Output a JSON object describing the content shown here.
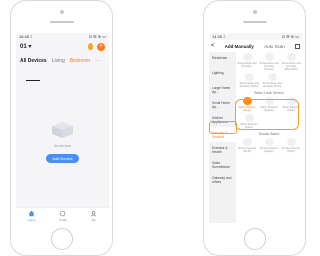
{
  "left_phone": {
    "status": {
      "time": "16:45 ☾",
      "icons": "⊡ ☰ ≋ ▭"
    },
    "home_name": "01 ▾",
    "tabs": [
      {
        "label": "All Devices",
        "state": "active"
      },
      {
        "label": "Living",
        "state": "inactive"
      },
      {
        "label": "Bedroom",
        "state": "orange"
      },
      {
        "label": "···",
        "state": "orange"
      }
    ],
    "empty_text": "No devices",
    "add_device_label": "Add Device",
    "nav": [
      {
        "label": "Home",
        "icon": "home-icon",
        "state": "active"
      },
      {
        "label": "Smart",
        "icon": "smart-icon",
        "state": "inactive"
      },
      {
        "label": "Me",
        "icon": "profile-icon",
        "state": "inactive"
      }
    ]
  },
  "right_phone": {
    "status": {
      "time": "14:35 ☾",
      "icons": "⊡ ☰ ≋ ▭"
    },
    "back": "<",
    "tab_manual": "Add Manually",
    "tab_auto": "Auto Scan",
    "categories": [
      {
        "label": "Electrician",
        "selected": false
      },
      {
        "label": "Lighting",
        "selected": false
      },
      {
        "label": "Large Home Ap...",
        "selected": false
      },
      {
        "label": "Small Home Ap...",
        "selected": false
      },
      {
        "label": "Kitchen Appliances",
        "selected": false
      },
      {
        "label": "Security & Sensors",
        "selected": true
      },
      {
        "label": "Exercise & Health",
        "selected": false
      },
      {
        "label": "Video Surveillance",
        "selected": false
      },
      {
        "label": "Gateway and others",
        "selected": false
      }
    ],
    "group_top": [
      {
        "label": "Temperature and Humidity...",
        "highlight": false
      },
      {
        "label": "Temperature and Humidity (Zigbee)",
        "highlight": false
      },
      {
        "label": "Temperature and Humidity (Bluetooth)",
        "highlight": false
      }
    ],
    "group_top2": [
      {
        "label": "Temperature and Humidity (Wi-Fi)",
        "highlight": false
      },
      {
        "label": "Temperature and Humidity (Wi-Fi)",
        "highlight": false
      }
    ],
    "water_leak_heading": "Water Leak Sensor",
    "water_leak_items": [
      {
        "label": "Water Detector (Wi-Fi)",
        "highlight": true
      },
      {
        "label": "Water Detector (Zigbee)",
        "highlight": false
      },
      {
        "label": "Water Detector (Other)",
        "highlight": false
      }
    ],
    "water_leak_items2": [
      {
        "label": "Water Detector (Other)",
        "highlight": false
      }
    ],
    "smoke_heading": "Smoke Alarm",
    "smoke_items": [
      {
        "label": "Smoke Detector (Wi-Fi)",
        "highlight": false
      },
      {
        "label": "Smoke Detector (Zigbee)",
        "highlight": false
      },
      {
        "label": "Smoke Detector (Other)",
        "highlight": false
      }
    ],
    "colors": {
      "accent": "#ff7a1a",
      "highlight_border": "#f0a030",
      "primary_blue": "#4a8ff7"
    }
  }
}
